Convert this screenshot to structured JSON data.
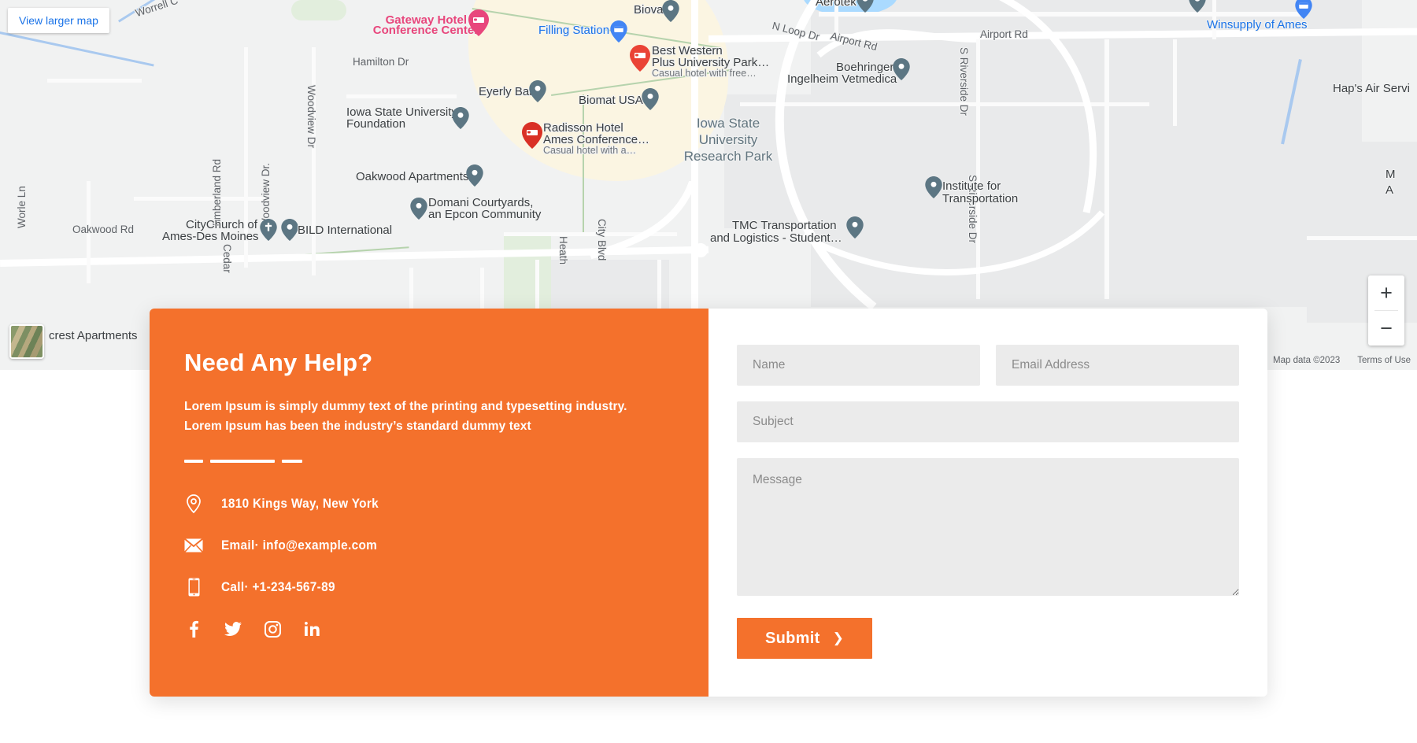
{
  "map": {
    "view_larger_label": "View larger map",
    "zoom_in_label": "+",
    "zoom_out_label": "−",
    "attribution": {
      "map_data": "Map data ©2023",
      "terms": "Terms of Use"
    },
    "pois": [
      {
        "name": "Gateway Hotel & Conference Center",
        "line1": "Gateway Hotel &",
        "line2": "Conference Center",
        "style": "pink",
        "pin": "hotel-pink"
      },
      {
        "name": "Filling Station",
        "line1": "Filling Station",
        "style": "blue",
        "pin": "store-blue"
      },
      {
        "name": "Best Western Plus University Park",
        "line1": "Best Western",
        "line2": "Plus University Park…",
        "sub": "Casual hotel with free…",
        "style": "poi",
        "pin": "hotel-red"
      },
      {
        "name": "Radisson Hotel Ames Conference",
        "line1": "Radisson Hotel",
        "line2": "Ames Conference…",
        "sub": "Casual hotel with a…",
        "style": "poi",
        "pin": "hotel-red"
      },
      {
        "name": "Eyerly Ball",
        "line1": "Eyerly Ball",
        "style": "poi",
        "pin": "grey"
      },
      {
        "name": "Biomat USA",
        "line1": "Biomat USA",
        "style": "poi",
        "pin": "grey"
      },
      {
        "name": "Iowa State University Foundation",
        "line1": "Iowa State University",
        "line2": "Foundation",
        "style": "poi",
        "pin": "grey"
      },
      {
        "name": "Oakwood Apartments",
        "line1": "Oakwood Apartments",
        "style": "poi",
        "pin": "grey"
      },
      {
        "name": "Domani Courtyards, an Epcon Community",
        "line1": "Domani Courtyards,",
        "line2": "an Epcon Community",
        "style": "poi",
        "pin": "grey"
      },
      {
        "name": "CityChurch of Ames-Des Moines",
        "line1": "CityChurch of",
        "line2": "Ames-Des Moines",
        "style": "poi",
        "pin": "church-grey"
      },
      {
        "name": "BILD International",
        "line1": "BILD International",
        "style": "poi",
        "pin": "grey"
      },
      {
        "name": "Biova",
        "line1": "Biova",
        "style": "poi",
        "pin": "grey"
      },
      {
        "name": "Aerotek",
        "line1": "Aerotek",
        "style": "poi",
        "pin": "grey"
      },
      {
        "name": "Boehringer Ingelheim Vetmedica",
        "line1": "Boehringer",
        "line2": "Ingelheim Vetmedica",
        "style": "poi",
        "pin": "grey"
      },
      {
        "name": "Winsupply of Ames",
        "line1": "Winsupply of Ames",
        "style": "blue",
        "pin": "store-blue"
      },
      {
        "name": "Institute for Transportation",
        "line1": "Institute for",
        "line2": "Transportation",
        "style": "poi",
        "pin": "grey"
      },
      {
        "name": "TMC Transportation and Logistics - Student",
        "line1": "TMC Transportation",
        "line2": "and Logistics - Student…",
        "style": "poi",
        "pin": "grey"
      },
      {
        "name": "Hap's Air Service",
        "line1": "Hap's Air Servi",
        "style": "poi",
        "pin": "none"
      },
      {
        "name": "crest Apartments",
        "line1": "crest Apartments",
        "style": "poi",
        "pin": "thumb"
      }
    ],
    "area_labels": [
      {
        "text": "Iowa State\nUniversity\nResearch Park"
      }
    ],
    "streets": [
      "Worrell C",
      "Hamilton Dr",
      "Woodview Dr",
      "Timberland Rd",
      "Woodview Dr.",
      "Cedar",
      "Oakwood Rd",
      "Heath",
      "City Blvd",
      "N Loop Dr",
      "Airport Rd",
      "Airport Rd",
      "S Riverside Dr",
      "S Riverside Dr",
      "Worle Ln"
    ]
  },
  "contact": {
    "title": "Need Any Help?",
    "paragraph_line1": "Lorem Ipsum is simply dummy text of the printing and typesetting industry.",
    "paragraph_line2": "Lorem Ipsum has been the industry’s standard dummy text",
    "address": "1810 Kings Way, New York",
    "email": "Email· info@example.com",
    "phone": "Call· +1-234-567-89",
    "socials": [
      {
        "name": "facebook",
        "label": "f"
      },
      {
        "name": "twitter",
        "label": "t"
      },
      {
        "name": "instagram",
        "label": "ig"
      },
      {
        "name": "linkedin",
        "label": "in"
      }
    ],
    "accent_color": "#f4712c"
  },
  "form": {
    "name_placeholder": "Name",
    "email_placeholder": "Email Address",
    "subject_placeholder": "Subject",
    "message_placeholder": "Message",
    "name_value": "",
    "email_value": "",
    "subject_value": "",
    "message_value": "",
    "submit_label": "Submit",
    "submit_chevron": "❯"
  }
}
